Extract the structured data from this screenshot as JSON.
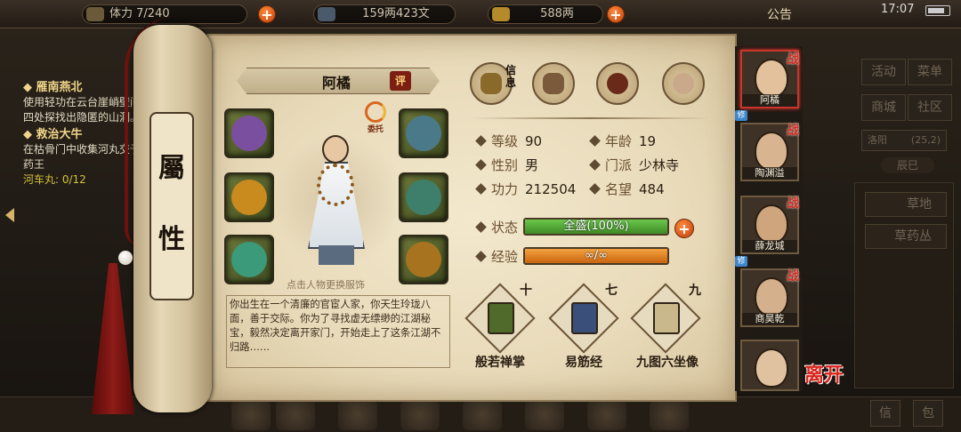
{
  "topbar": {
    "stamina": "7/240",
    "stamina_prefix": "体力",
    "coins": "159两423文",
    "silver": "588两",
    "notice": "公告",
    "time": "17:07"
  },
  "quests": [
    {
      "title": "雁南燕北",
      "desc": "使用轻功在云台崖峭壁间四处探找出隐匿的山洞。"
    },
    {
      "title": "救治大牛",
      "desc": "在枯骨门中收集河丸交予药王",
      "progress": "河车丸: 0/12"
    }
  ],
  "right_menu": {
    "activity": "活动",
    "menu": "菜单",
    "shop": "商城",
    "community": "社区",
    "location": "洛阳",
    "coords": "(25,2)",
    "time_tab": "辰巳",
    "items": [
      "草地",
      "草药丛"
    ],
    "bottom_left": "信",
    "bottom_right": "包"
  },
  "scroll": {
    "title_top": "屬",
    "title_bottom": "性"
  },
  "character": {
    "name": "阿橘",
    "rate_label": "评",
    "entrust_label": "委托",
    "change_outfit_hint": "点击人物更换服饰",
    "story": "你出生在一个清廉的官宦人家，你天生玲珑八面，善于交际。你为了寻找虚无缥缈的江湖秘宝，毅然决定离开家门，开始走上了这条江湖不归路……",
    "info_tab_label": "信息",
    "stats": {
      "level_label": "等级",
      "level": "90",
      "age_label": "年龄",
      "age": "19",
      "gender_label": "性别",
      "gender": "男",
      "sect_label": "门派",
      "sect": "少林寺",
      "power_label": "功力",
      "power": "212504",
      "fame_label": "名望",
      "fame": "484"
    },
    "status_label": "状态",
    "status_value": "全盛(100%)",
    "status_fill": 1.0,
    "exp_label": "经验",
    "exp_value": "∞/∞",
    "exp_fill": 1.0
  },
  "skills": [
    {
      "name": "般若禅掌",
      "level": "十"
    },
    {
      "name": "易筋经",
      "level": "七"
    },
    {
      "name": "九图六坐像",
      "level": "九"
    }
  ],
  "party": [
    {
      "name": "阿橘",
      "badge": "战",
      "tag": "修"
    },
    {
      "name": "陶渊溢",
      "badge": "战",
      "tag": ""
    },
    {
      "name": "薛龙城",
      "badge": "战",
      "tag": "修"
    },
    {
      "name": "商昊乾",
      "badge": "战",
      "tag": ""
    },
    {
      "name": "",
      "badge": "",
      "tag": ""
    }
  ],
  "leave_label": "离开",
  "colors": {
    "status_bar": "#4f9e33",
    "exp_bar": "#e0801f",
    "accent_red": "#d42b1e"
  }
}
